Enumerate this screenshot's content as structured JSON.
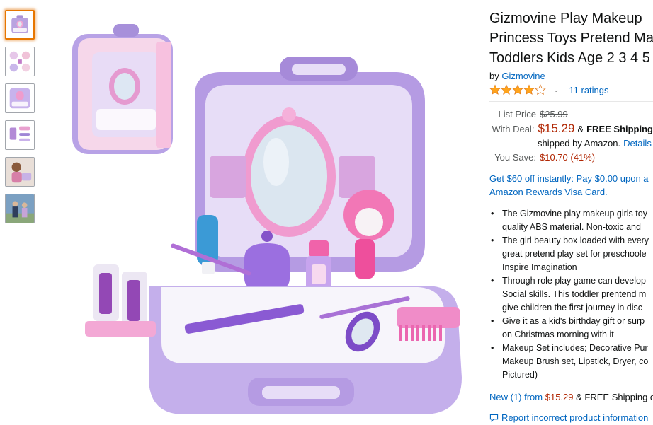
{
  "thumbnails": [
    {
      "alt": "thumbnail-1",
      "selected": true
    },
    {
      "alt": "thumbnail-2",
      "selected": false
    },
    {
      "alt": "thumbnail-3",
      "selected": false
    },
    {
      "alt": "thumbnail-4",
      "selected": false
    },
    {
      "alt": "thumbnail-5",
      "selected": false
    },
    {
      "alt": "thumbnail-6",
      "selected": false
    }
  ],
  "product": {
    "title_lines": [
      "Gizmovine Play Makeup",
      "Princess Toys Pretend Ma",
      "Toddlers Kids Age 2 3 4 5"
    ],
    "by_prefix": "by",
    "brand": "Gizmovine",
    "rating_stars": 4,
    "ratings_count": "11 ratings"
  },
  "pricing": {
    "list_price_label": "List Price",
    "list_price": "$25.99",
    "deal_label": "With Deal:",
    "deal_price": "$15.29",
    "amp": "&",
    "free_shipping": "FREE Shipping",
    "shipped_by": "shipped by Amazon.",
    "details": "Details",
    "save_label": "You Save:",
    "save_value": "$10.70 (41%)"
  },
  "promo": {
    "line1": "Get $60 off instantly: Pay $0.00 upon a",
    "line2": "Amazon Rewards Visa Card."
  },
  "bullets": [
    [
      "The Gizmovine play makeup girls toy",
      "quality ABS material. Non-toxic and"
    ],
    [
      "The girl beauty box loaded with every",
      "great pretend play set for preschoole",
      "Inspire Imagination"
    ],
    [
      "Through role play game can develop",
      "Social skills. This toddler prentend m",
      "give children the first journey in disc"
    ],
    [
      "Give it as a kid's birthday gift or surp",
      "on Christmas morning with it"
    ],
    [
      "Makeup Set includes; Decorative Pur",
      "Makeup Brush set, Lipstick, Dryer, co",
      "Pictured)"
    ]
  ],
  "offers": {
    "new_link": "New (1) from",
    "new_price": "$15.29",
    "new_suffix": "& FREE Shipping o"
  },
  "report": {
    "label": "Report incorrect product information"
  },
  "colors": {
    "link": "#0066c0",
    "price": "#b12704",
    "star": "#ffa41c",
    "selected_thumb": "#e77600"
  }
}
